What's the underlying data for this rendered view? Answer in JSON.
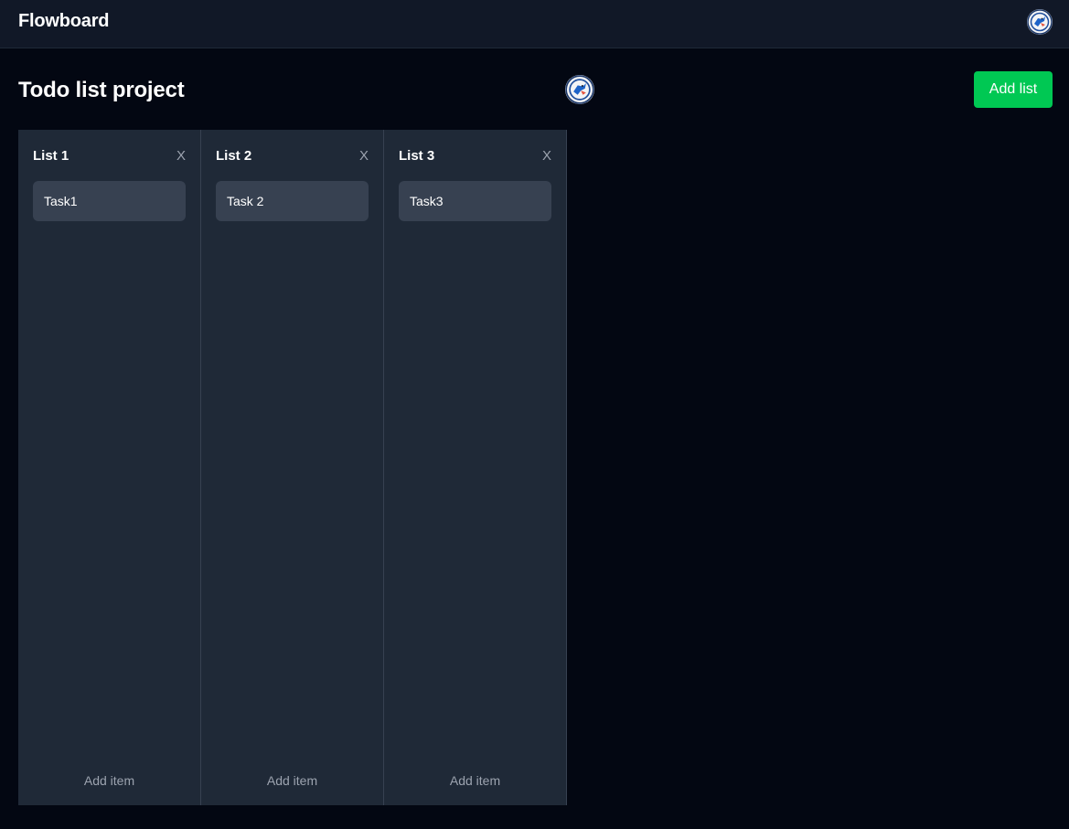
{
  "app": {
    "brand": "Flowboard"
  },
  "project": {
    "title": "Todo list project",
    "add_list_label": "Add list"
  },
  "lists": [
    {
      "title": "List 1",
      "close": "X",
      "tasks": [
        "Task1"
      ],
      "add_item_label": "Add item"
    },
    {
      "title": "List 2",
      "close": "X",
      "tasks": [
        "Task 2"
      ],
      "add_item_label": "Add item"
    },
    {
      "title": "List 3",
      "close": "X",
      "tasks": [
        "Task3"
      ],
      "add_item_label": "Add item"
    }
  ],
  "icons": {
    "user_avatar": "user-avatar-icon"
  },
  "colors": {
    "background": "#030712",
    "topbar": "#111827",
    "list_bg": "#1f2937",
    "task_bg": "#374151",
    "accent": "#00c853"
  }
}
